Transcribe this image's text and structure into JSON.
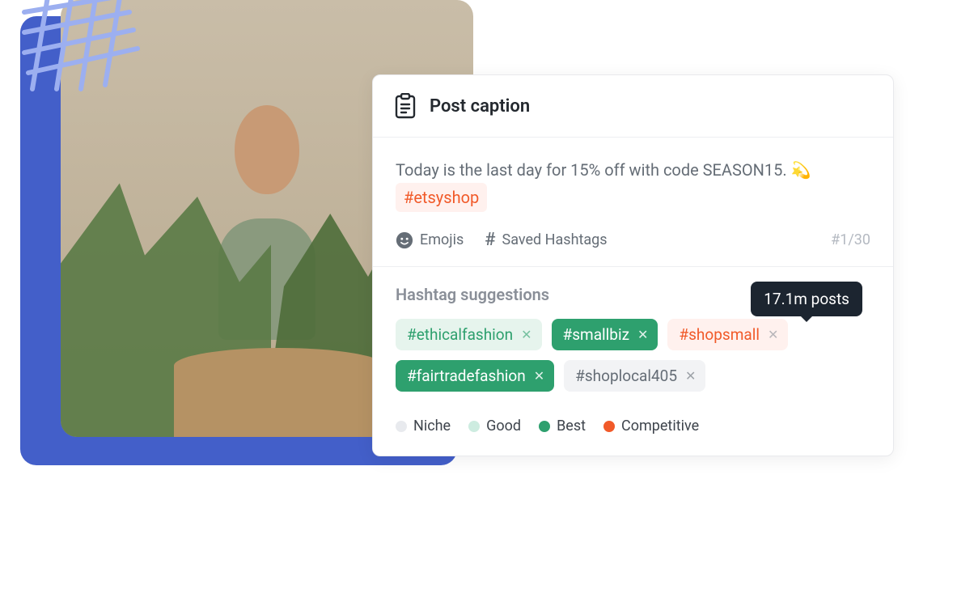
{
  "card": {
    "title": "Post caption",
    "caption_text": "Today is the last day for 15% off with code SEASON15. ",
    "caption_emoji": "💫",
    "inline_hashtag": "#etsyshop",
    "emojis_label": "Emojis",
    "saved_hashtags_label": "Saved Hashtags",
    "counter": "#1/30",
    "hashtag_suggestions_title": "Hashtag suggestions",
    "tooltip": "17.1m posts",
    "chips": [
      {
        "label": "#ethicalfashion",
        "tier": "good"
      },
      {
        "label": "#smallbiz",
        "tier": "best"
      },
      {
        "label": "#shopsmall",
        "tier": "competitive"
      },
      {
        "label": "#fairtradefashion",
        "tier": "best"
      },
      {
        "label": "#shoplocal405",
        "tier": "niche"
      }
    ],
    "legend": {
      "niche": "Niche",
      "good": "Good",
      "best": "Best",
      "competitive": "Competitive"
    }
  },
  "colors": {
    "accent_orange": "#f15a29",
    "accent_green": "#2ea06e",
    "brand_blue": "#435fc9"
  }
}
